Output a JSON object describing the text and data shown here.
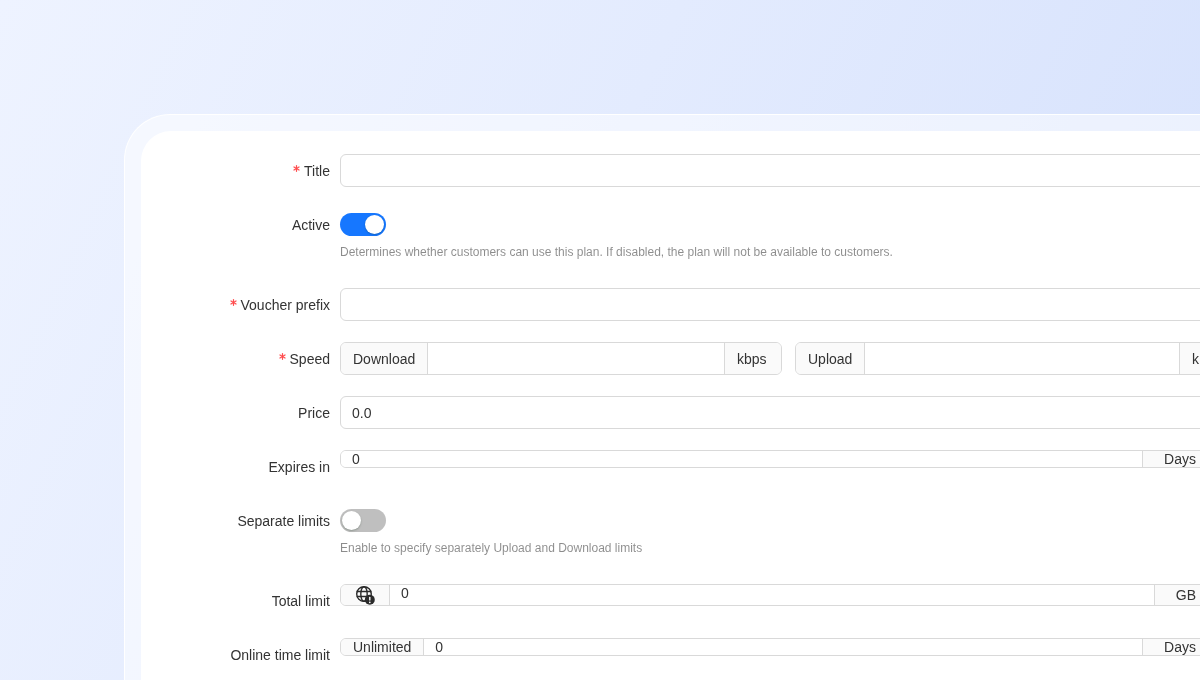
{
  "form": {
    "fields": [
      {
        "kind": "input",
        "label": "Title",
        "required": true
      },
      {
        "kind": "switch",
        "label": "Active",
        "required": false,
        "on": true,
        "help": "Determines whether customers can use this plan. If disabled, the plan will not be available to customers."
      },
      {
        "kind": "input",
        "label": "Voucher prefix",
        "required": true
      },
      {
        "kind": "pair",
        "label": "Speed",
        "required": true,
        "groups": [
          {
            "prefix": {
              "kind": "text",
              "text": "Download"
            },
            "suffix": "kbps"
          },
          {
            "prefix": {
              "kind": "text",
              "text": "Upload"
            },
            "suffix": "k"
          }
        ]
      },
      {
        "kind": "input",
        "label": "Price",
        "required": false,
        "value": "0.0"
      },
      {
        "kind": "input",
        "label": "Expires in",
        "required": false,
        "value": "0",
        "suffix": "Days"
      },
      {
        "kind": "switch",
        "label": "Separate limits",
        "required": false,
        "on": false,
        "help": "Enable to specify separately Upload and Download limits"
      },
      {
        "kind": "input",
        "label": "Total limit",
        "required": false,
        "prefix": {
          "kind": "icon"
        },
        "value": "0",
        "suffix": "GB"
      },
      {
        "kind": "input",
        "label": "Online time limit",
        "required": false,
        "prefix": {
          "kind": "text",
          "text": "Unlimited"
        },
        "value": "0",
        "suffix": "Days"
      }
    ]
  }
}
